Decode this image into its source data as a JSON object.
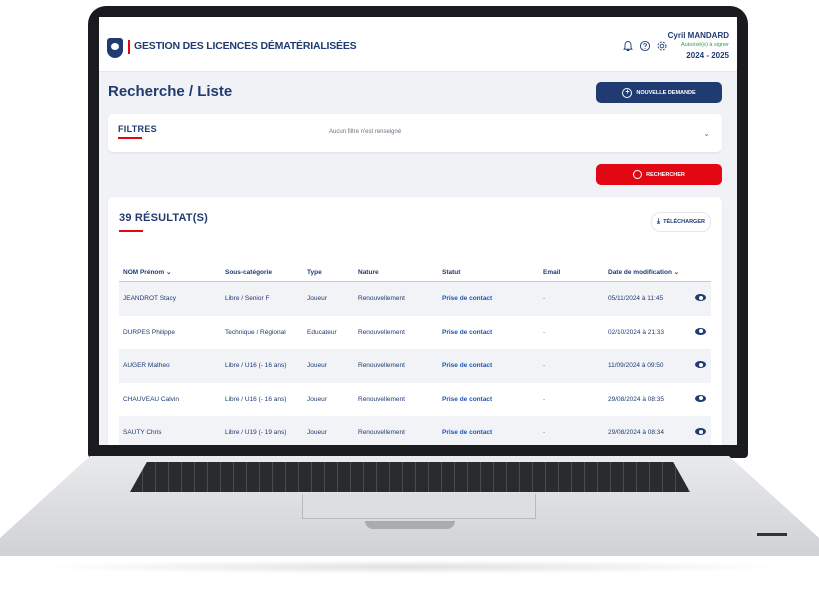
{
  "header": {
    "app_title": "GESTION DES LICENCES DÉMATÉRIALISÉES",
    "user_name": "Cyril MANDARD",
    "user_role": "Autorisé(e) à signer",
    "season": "2024 - 2025"
  },
  "page": {
    "title": "Recherche / Liste",
    "new_request_label": "NOUVELLE DEMANDE"
  },
  "filters": {
    "title": "FILTRES",
    "empty_message": "Aucun filtre n'est renseigné",
    "search_label": "RECHERCHER"
  },
  "results": {
    "title": "39 RÉSULTAT(S)",
    "download_label": "TÉLÉCHARGER",
    "columns": {
      "name": "NOM Prénom",
      "subcategory": "Sous-catégorie",
      "type": "Type",
      "nature": "Nature",
      "status": "Statut",
      "email": "Email",
      "date": "Date de modification"
    },
    "rows": [
      {
        "name": "JEANDROT Stacy",
        "subcategory": "Libre / Senior F",
        "type": "Joueur",
        "nature": "Renouvellement",
        "status": "Prise de contact",
        "email": "-",
        "date": "05/11/2024 à 11:45"
      },
      {
        "name": "DURPES Philippe",
        "subcategory": "Technique / Régional",
        "type": "Educateur",
        "nature": "Renouvellement",
        "status": "Prise de contact",
        "email": "-",
        "date": "02/10/2024 à 21:33"
      },
      {
        "name": "AUGER Matheo",
        "subcategory": "Libre / U16 (- 16 ans)",
        "type": "Joueur",
        "nature": "Renouvellement",
        "status": "Prise de contact",
        "email": "-",
        "date": "11/09/2024 à 09:50"
      },
      {
        "name": "CHAUVEAU Calvin",
        "subcategory": "Libre / U16 (- 16 ans)",
        "type": "Joueur",
        "nature": "Renouvellement",
        "status": "Prise de contact",
        "email": "-",
        "date": "29/08/2024 à 08:35"
      },
      {
        "name": "SAUTY Chris",
        "subcategory": "Libre / U19 (- 19 ans)",
        "type": "Joueur",
        "nature": "Renouvellement",
        "status": "Prise de contact",
        "email": "-",
        "date": "29/08/2024 à 08:34"
      }
    ]
  },
  "colors": {
    "primary": "#1f3b72",
    "accent_red": "#e30613",
    "link_blue": "#1e56b7",
    "role_green": "#2e9e4a"
  },
  "icons": [
    "federation-logo-icon",
    "bell-icon",
    "help-icon",
    "gear-icon",
    "plus-circle-icon",
    "chevron-down-icon",
    "search-icon",
    "download-icon",
    "eye-icon"
  ]
}
